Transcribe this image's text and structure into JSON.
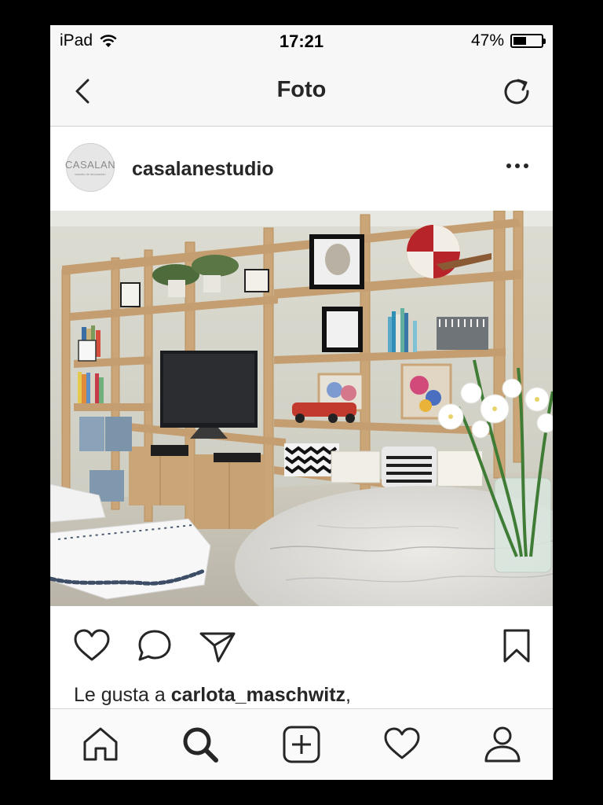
{
  "status_bar": {
    "device": "iPad",
    "time": "17:21",
    "battery_percent": "47%",
    "battery_level": 0.47,
    "wifi_icon": "wifi-icon"
  },
  "nav": {
    "title": "Foto",
    "back_icon": "chevron-left-icon",
    "refresh_icon": "refresh-icon"
  },
  "post": {
    "avatar_text": "CASALAN",
    "avatar_subtext": "estudio de decoración",
    "username": "casalanestudio",
    "more_icon": "more-horizontal-icon",
    "image_alt": "Living room with wooden shelving, TV, marble table and white flowers"
  },
  "actions": {
    "like_icon": "heart-icon",
    "comment_icon": "comment-icon",
    "share_icon": "send-icon",
    "save_icon": "bookmark-icon"
  },
  "likes": {
    "prefix": "Le gusta a ",
    "user": "carlota_maschwitz",
    "suffix": ","
  },
  "tabbar": {
    "items": [
      "home-icon",
      "search-icon",
      "new-post-icon",
      "activity-icon",
      "profile-icon"
    ]
  },
  "colors": {
    "text": "#262626",
    "bar_bg": "#f7f7f7",
    "wall": "#d9d8ce",
    "wood": "#c9a577"
  }
}
